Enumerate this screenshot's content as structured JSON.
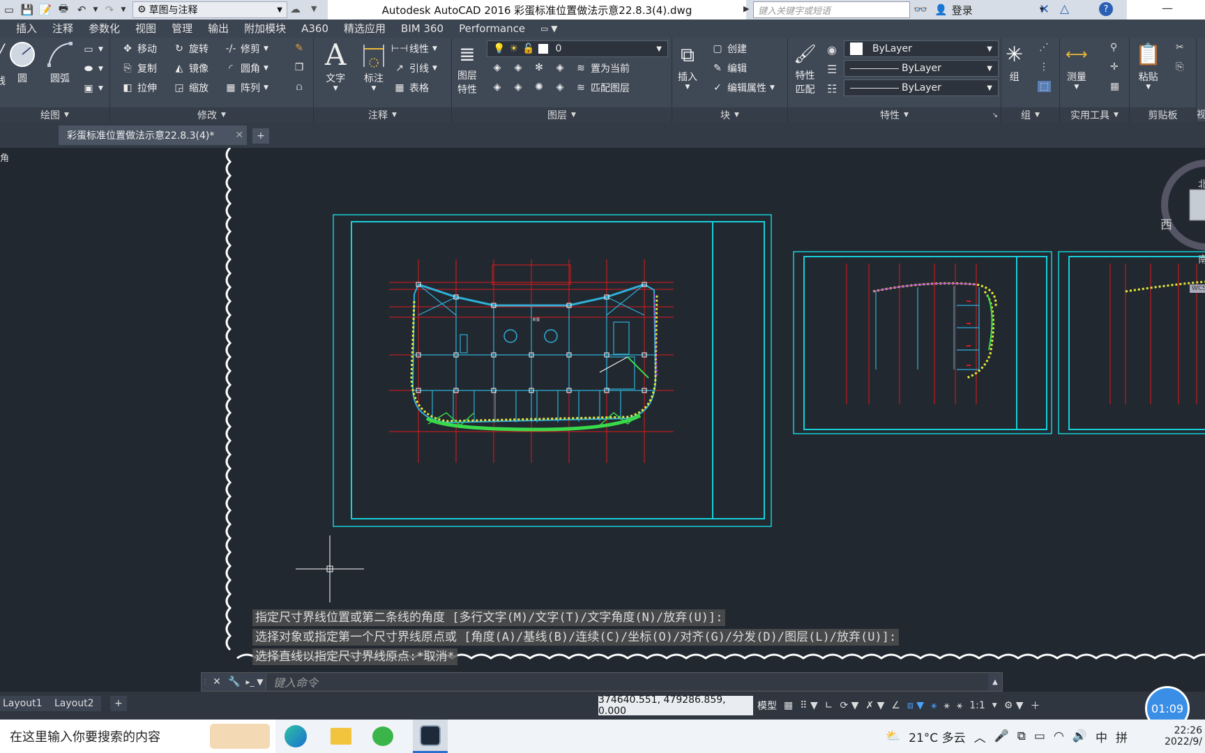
{
  "titlebar": {
    "workspace": "草图与注释",
    "window_title": "Autodesk AutoCAD 2016    彩蛋标准位置做法示意22.8.3(4).dwg",
    "search_placeholder": "键入关键字或短语",
    "login": "登录"
  },
  "menu": [
    "插入",
    "注释",
    "参数化",
    "视图",
    "管理",
    "输出",
    "附加模块",
    "A360",
    "精选应用",
    "BIM 360",
    "Performance"
  ],
  "ribbon": {
    "draw": {
      "title": "绘图",
      "circle": "圆",
      "arc": "圆弧",
      "left_cut": "线"
    },
    "modify": {
      "title": "修改",
      "move": "移动",
      "rotate": "旋转",
      "trim": "修剪",
      "copy": "复制",
      "mirror": "镜像",
      "fillet": "圆角",
      "stretch": "拉伸",
      "scale": "缩放",
      "array": "阵列"
    },
    "annotation": {
      "title": "注释",
      "text": "文字",
      "dimension": "标注",
      "linear": "线性",
      "leader": "引线",
      "table": "表格"
    },
    "layers": {
      "title": "图层",
      "layer_props_1": "图层",
      "layer_props_2": "特性",
      "current_layer": "0",
      "set_current": "置为当前",
      "match_layer": "匹配图层"
    },
    "block": {
      "title": "块",
      "insert": "插入",
      "create": "创建",
      "edit": "编辑",
      "edit_attr": "编辑属性"
    },
    "properties": {
      "title": "特性",
      "match_1": "特性",
      "match_2": "匹配",
      "color": "ByLayer",
      "linetype": "ByLayer",
      "lineweight": "ByLayer"
    },
    "group": {
      "title": "组",
      "group": "组"
    },
    "utilities": {
      "title": "实用工具",
      "measure": "测量"
    },
    "clipboard": {
      "title": "剪贴板",
      "paste": "粘贴"
    },
    "view_cut": "视"
  },
  "doc_tab": {
    "name": "彩蛋标准位置做法示意22.8.3(4)*",
    "close": "✕",
    "add": "+"
  },
  "canvas": {
    "corner_label": "角",
    "viewcube_west": "西",
    "viewcube_north": "北",
    "viewcube_south": "南",
    "wcs": "WCS",
    "drawing_note": "彩蛋"
  },
  "command_history": [
    "指定尺寸界线位置或第二条线的角度 [多行文字(M)/文字(T)/文字角度(N)/放弃(U)]:",
    "选择对象或指定第一个尺寸界线原点或 [角度(A)/基线(B)/连续(C)/坐标(O)/对齐(G)/分发(D)/图层(L)/放弃(U)]:",
    "选择直线以指定尺寸界线原点:*取消*"
  ],
  "command_input_placeholder": "键入命令",
  "layouts": [
    "Layout1",
    "Layout2"
  ],
  "layout_add": "+",
  "status": {
    "coords": "374640.551, 479286.859, 0.000",
    "model": "模型",
    "scale": "1:1"
  },
  "taskbar": {
    "search_placeholder": "在这里输入你要搜索的内容",
    "weather": "21°C 多云",
    "ime": "中",
    "ime2": "拼",
    "time": "22:26",
    "date": "2022/9/"
  },
  "timer": "01:09",
  "colors": {
    "canvas": "#212830",
    "frame": "#17d0d8",
    "grid": "#e01a1a",
    "structure": "#2fb0d8",
    "accent_yellow": "#e8e83a",
    "accent_green": "#39d94a"
  }
}
